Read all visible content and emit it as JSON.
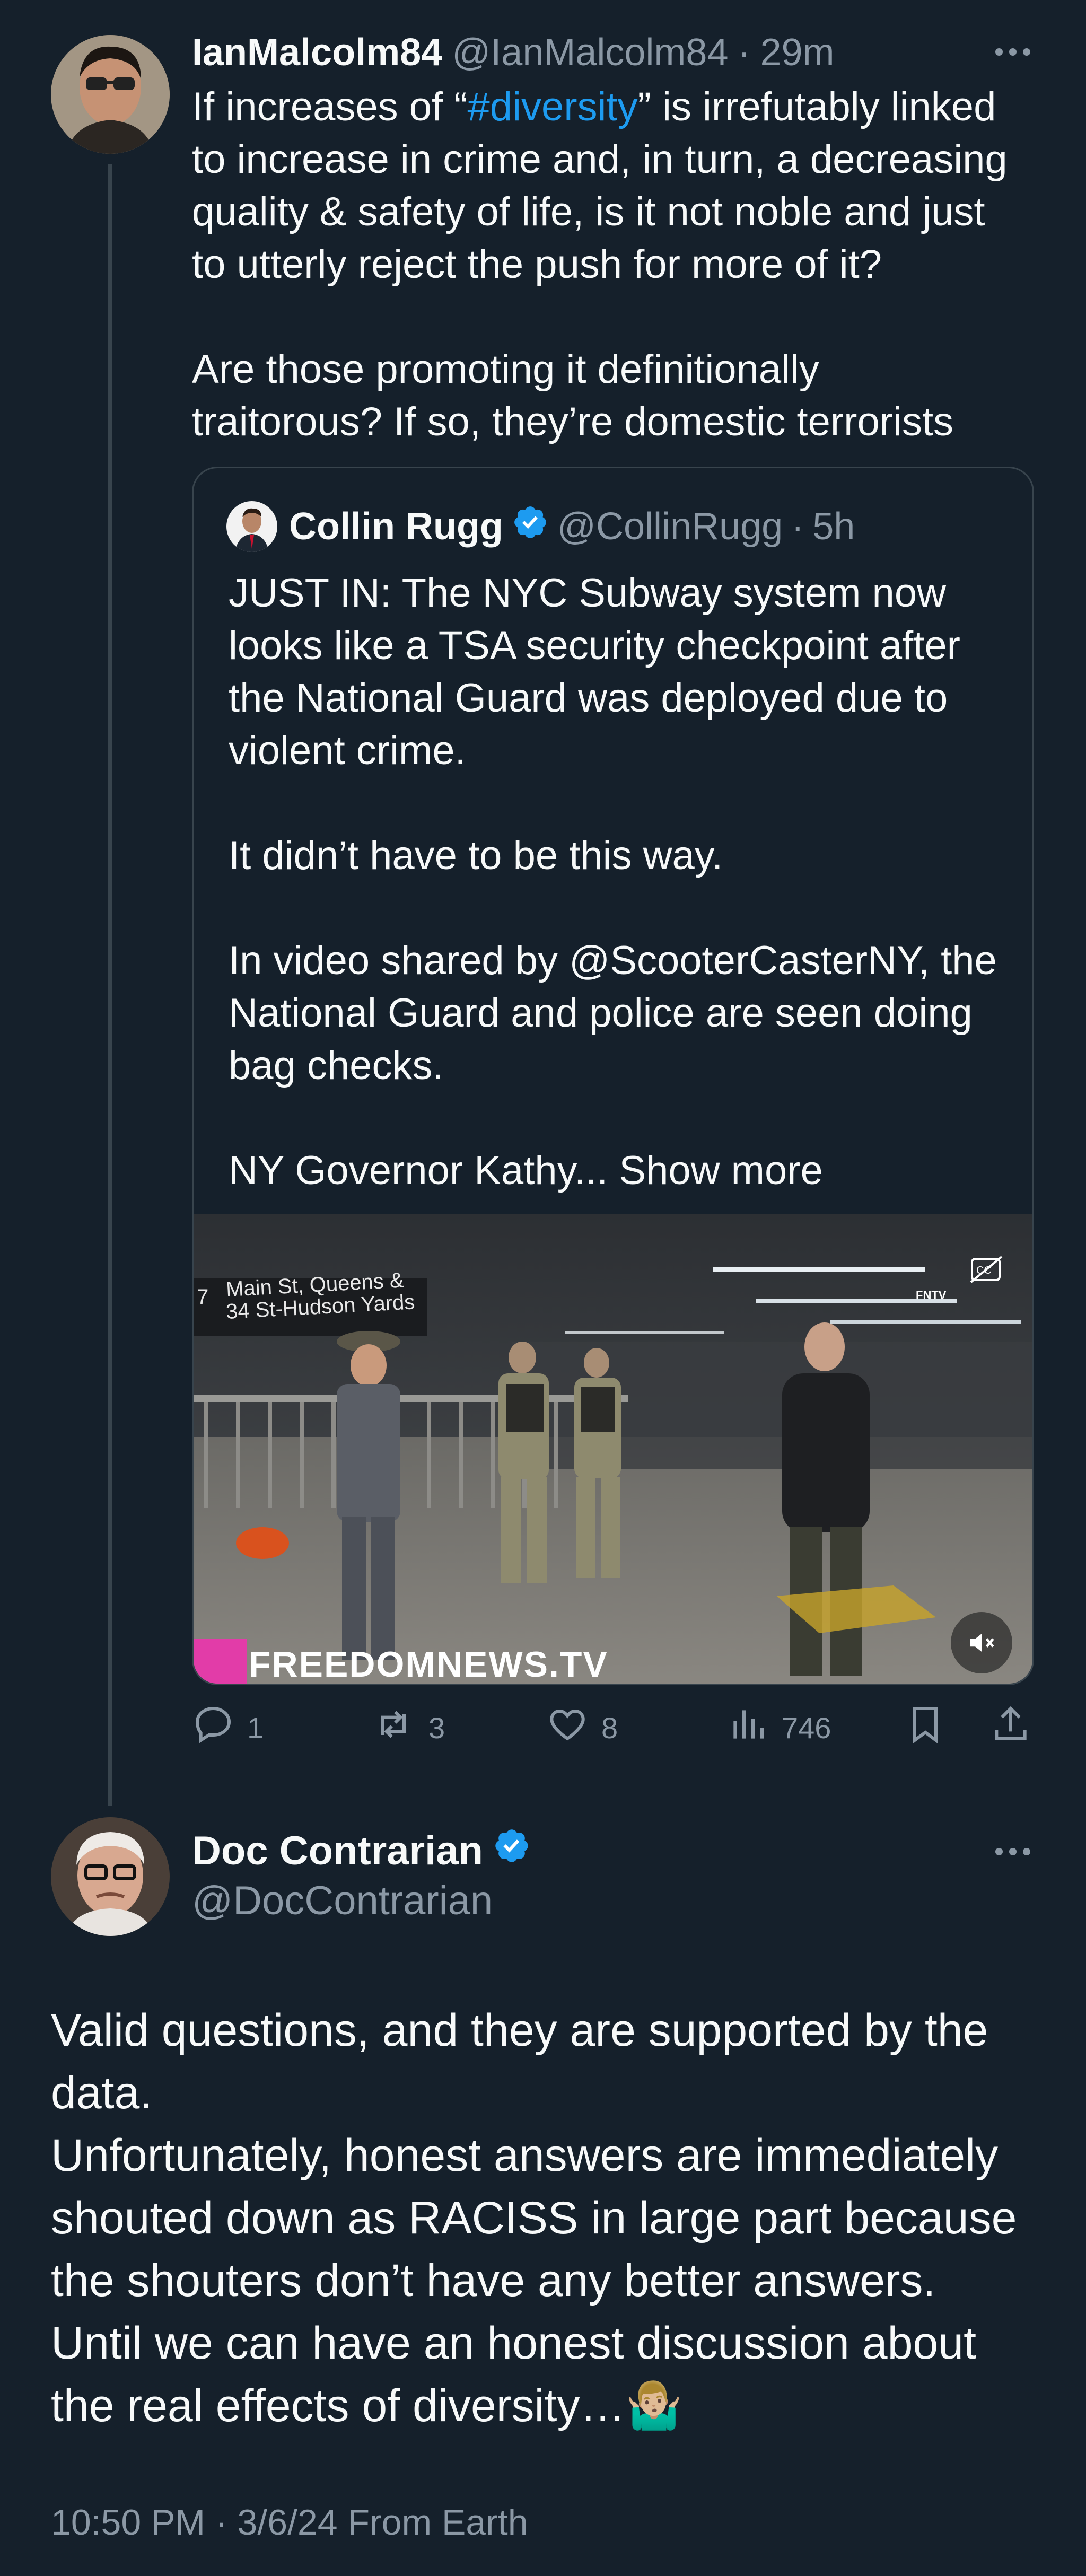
{
  "parent_tweet": {
    "display_name": "IanMalcolm84",
    "handle": "@IanMalcolm84",
    "separator": "·",
    "time": "29m",
    "text_before_hashtag": "If increases of “",
    "hashtag": "#diversity",
    "text_after_hashtag": "” is irrefutably linked\nto increase in crime and, in turn, a decreasing\nquality & safety of life, is it not noble and just\nto utterly reject the push for more of it?\n\nAre those promoting it definitionally\ntraitorous? If so, they’re domestic terrorists"
  },
  "quoted_tweet": {
    "display_name": "Collin Rugg",
    "handle": "@CollinRugg",
    "separator": "·",
    "time": "5h",
    "text": "JUST IN: The NYC Subway system now\nlooks like a TSA security checkpoint after\nthe National Guard was deployed due to\nviolent crime.\n\nIt didn’t have to be this way.\n\nIn video shared by @ScooterCasterNY, the\nNational Guard and police are seen doing\nbag checks.\n\nNY Governor Kathy...",
    "show_more": "Show more",
    "video": {
      "sign_line1": "Main St, Queens &",
      "sign_line2": "34 St-Hudson Yards",
      "sign_number": "7",
      "channel_badge": "FNTV",
      "watermark": "FREEDOMNEWS.TV"
    }
  },
  "actions": {
    "replies": "1",
    "reposts": "3",
    "likes": "8",
    "views": "746"
  },
  "reply_tweet": {
    "display_name": "Doc Contrarian",
    "handle": "@DocContrarian",
    "text": "Valid questions, and they are supported by the data.\nUnfortunately, honest answers are immediately shouted down as RACISS in large part because the shouters don’t have any better answers.\nUntil we can have an honest discussion about the real effects of diversity…",
    "emoji": "🤷🏼‍♂️",
    "timestamp": "10:50 PM · 3/6/24 From Earth"
  },
  "colors": {
    "background": "#15202b",
    "text": "#f7f9f9",
    "muted": "#8b98a5",
    "accent": "#1d9bf0",
    "border": "#38444d"
  }
}
